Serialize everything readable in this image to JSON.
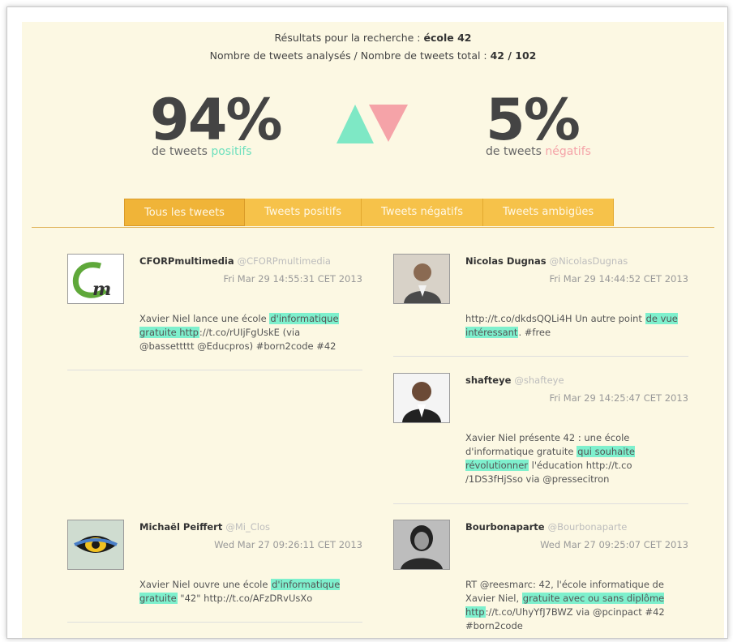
{
  "header": {
    "search_prefix": "Résultats pour la recherche : ",
    "search_term": "école 42",
    "count_prefix": "Nombre de tweets analysés / Nombre de tweets total : ",
    "count_value": "42 / 102"
  },
  "stats": {
    "positive_pct": "94%",
    "positive_sub_prefix": "de tweets ",
    "positive_word": "positifs",
    "negative_pct": "5%",
    "negative_sub_prefix": "de tweets ",
    "negative_word": "négatifs"
  },
  "colors": {
    "positive": "#6de0bd",
    "negative": "#f5a3a8",
    "tab": "#f6c24a",
    "panel": "#fcf8e3",
    "highlight": "#7ef0cd"
  },
  "tabs": [
    {
      "label": "Tous les tweets",
      "active": true
    },
    {
      "label": "Tweets positifs"
    },
    {
      "label": "Tweets négatifs"
    },
    {
      "label": "Tweets ambigües"
    }
  ],
  "tweets": {
    "t1": {
      "name": "CFORPmultimedia",
      "handle": "@CFORPmultimedia",
      "date": "Fri Mar 29 14:55:31 CET 2013",
      "pre": "Xavier Niel lance une école ",
      "hl": "d'informatique gratuite http",
      "post": "://t.co/rUIjFgUskE (via @bassettttt @Educpros) #born2code #42"
    },
    "t2": {
      "name": "Nicolas Dugnas",
      "handle": "@NicolasDugnas",
      "date": "Fri Mar 29 14:44:52 CET 2013",
      "pre": "http://t.co/dkdsQQLi4H Un autre point ",
      "hl": "de vue intéressant",
      "post": ". #free"
    },
    "t3": {
      "name": "shafteye",
      "handle": "@shafteye",
      "date": "Fri Mar 29 14:25:47 CET 2013",
      "pre": "Xavier Niel présente 42 : une école d'informatique gratuite ",
      "hl": "qui souhaite révolutionner",
      "post": " l'éducation http://t.co /1DS3fHjSso via @pressecitron"
    },
    "t4": {
      "name": "Michaël Peiffert",
      "handle": "@Mi_Clos",
      "date": "Wed Mar 27 09:26:11 CET 2013",
      "pre": "Xavier Niel ouvre une école ",
      "hl": "d'informatique gratuite",
      "post": " \"42\" http://t.co/AFzDRvUsXo"
    },
    "t5": {
      "name": "Bourbonaparte",
      "handle": "@Bourbonaparte",
      "date": "Wed Mar 27 09:25:07 CET 2013",
      "pre": "RT @reesmarc: 42, l'école informatique de Xavier Niel, ",
      "hl": "gratuite avec ou sans diplôme http",
      "post": "://t.co/UhyYfJ7BWZ via @pcinpact #42 #born2code"
    }
  }
}
